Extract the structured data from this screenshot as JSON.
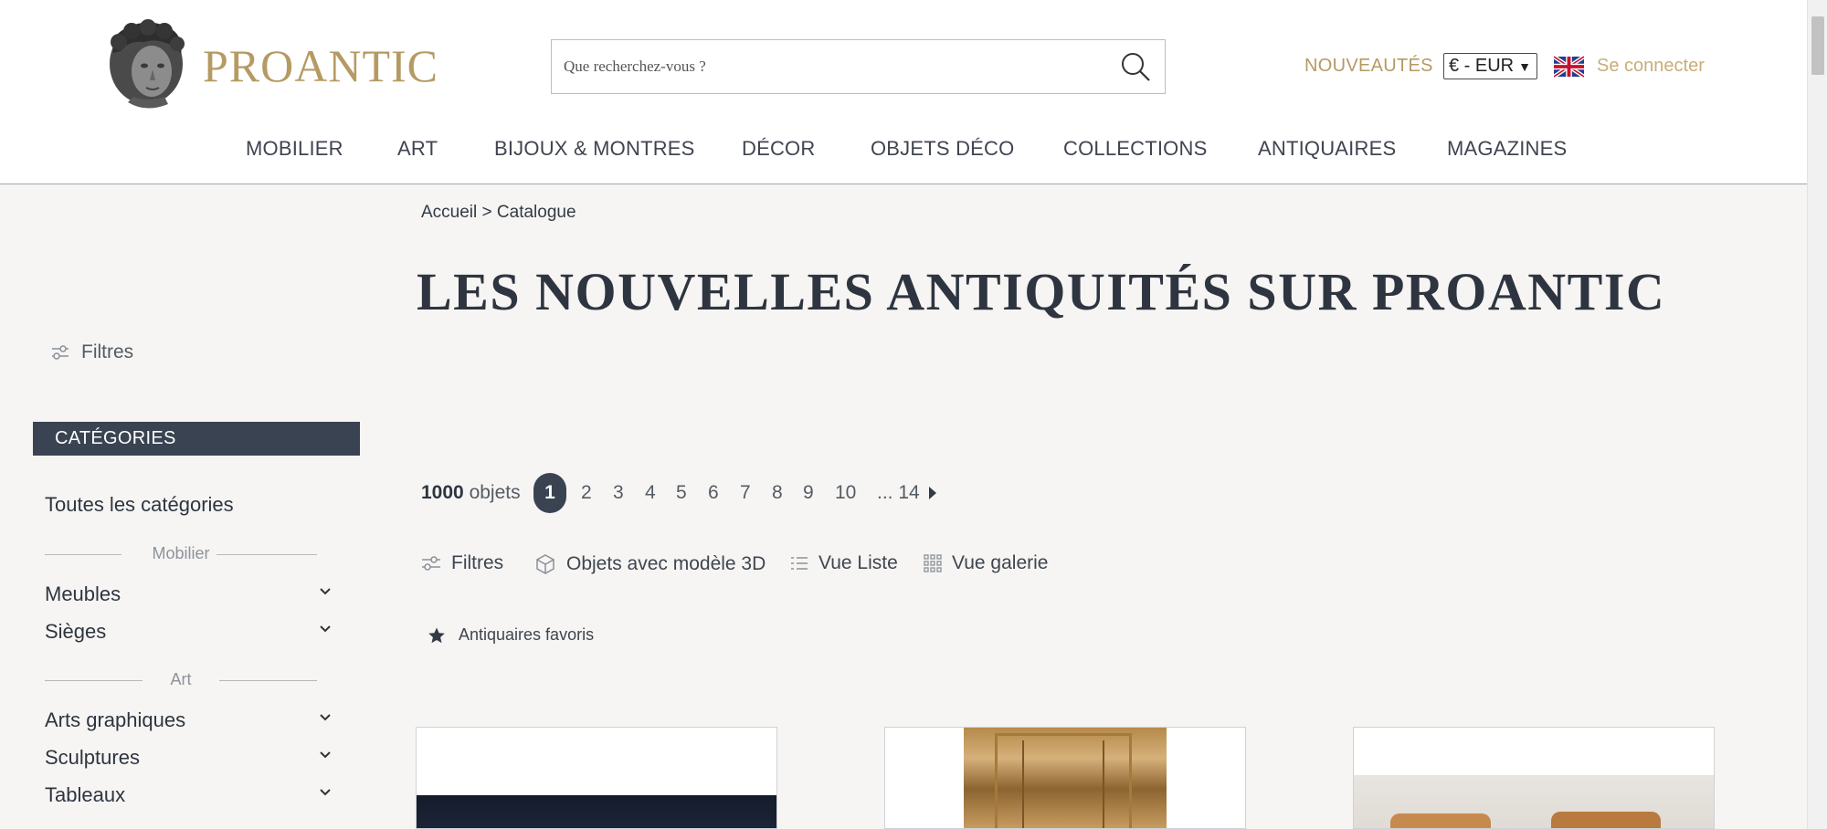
{
  "brand": {
    "name": "PROANTIC",
    "accent": "#b59a63",
    "dark": "#3a4352"
  },
  "search": {
    "placeholder": "Que recherchez-vous ?"
  },
  "header": {
    "new_label": "NOUVEAUTÉS",
    "currency_value": "€ - EUR",
    "signin_label": "Se connecter",
    "flag_icon": "uk-flag-icon"
  },
  "nav": {
    "items": [
      {
        "label": "MOBILIER"
      },
      {
        "label": "ART"
      },
      {
        "label": "BIJOUX & MONTRES"
      },
      {
        "label": "DÉCOR"
      },
      {
        "label": "OBJETS DÉCO"
      },
      {
        "label": "COLLECTIONS"
      },
      {
        "label": "ANTIQUAIRES"
      },
      {
        "label": "MAGAZINES"
      }
    ]
  },
  "breadcrumb": {
    "home": "Accueil",
    "separator": ">",
    "current": "Catalogue"
  },
  "page_title": "LES NOUVELLES ANTIQUITÉS SUR PROANTIC",
  "sidebar": {
    "filters_label": "Filtres",
    "categories_header": "CATÉGORIES",
    "all_categories": "Toutes les catégories",
    "groups": [
      {
        "label": "Mobilier",
        "items": [
          {
            "label": "Meubles"
          },
          {
            "label": "Sièges"
          }
        ]
      },
      {
        "label": "Art",
        "items": [
          {
            "label": "Arts graphiques"
          },
          {
            "label": "Sculptures"
          },
          {
            "label": "Tableaux"
          }
        ]
      }
    ]
  },
  "pagination": {
    "count_number": "1000",
    "count_label": "objets",
    "current_page": "1",
    "pages": [
      "2",
      "3",
      "4",
      "5",
      "6",
      "7",
      "8",
      "9",
      "10"
    ],
    "last_page": "... 14"
  },
  "toolbar": {
    "filters_label": "Filtres",
    "models3d_label": "Objets avec modèle 3D",
    "list_view_label": "Vue Liste",
    "gallery_view_label": "Vue galerie",
    "favorites_label": "Antiquaires favoris"
  }
}
